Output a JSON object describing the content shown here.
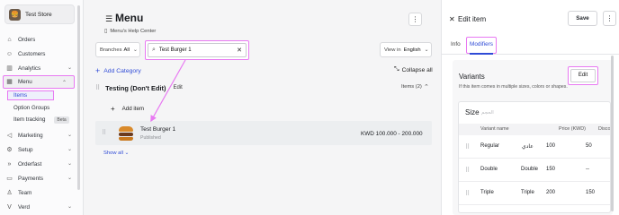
{
  "store": {
    "name": "Test Store",
    "logo_icon": "store-logo-icon"
  },
  "sidebar": {
    "items": [
      {
        "label": "Orders",
        "icon": "home-icon"
      },
      {
        "label": "Customers",
        "icon": "users-icon"
      },
      {
        "label": "Analytics",
        "icon": "chart-icon"
      },
      {
        "label": "Menu",
        "icon": "grid-icon"
      },
      {
        "label": "Marketing",
        "icon": "megaphone-icon"
      },
      {
        "label": "Setup",
        "icon": "gear-icon"
      },
      {
        "label": "Orderfast",
        "icon": "bolt-icon"
      },
      {
        "label": "Payments",
        "icon": "card-icon"
      },
      {
        "label": "Team",
        "icon": "person-icon"
      },
      {
        "label": "Verd",
        "icon": "verd-icon"
      }
    ],
    "menu_sub": [
      {
        "label": "Items"
      },
      {
        "label": "Option Groups"
      },
      {
        "label": "Item tracking",
        "badge": "Beta"
      }
    ]
  },
  "main": {
    "title": "Menu",
    "help": "Menu's Help Center",
    "branches_label": "Branches",
    "branches_value": "All",
    "search_value": "Test Burger 1",
    "view_in_label": "View in",
    "view_in_value": "English",
    "add_category": "Add Category",
    "collapse_all": "Collapse all",
    "category": {
      "title": "Testing (Don't Edit)",
      "edit": "Edit",
      "items_count": "Items (2)",
      "add_item": "Add item"
    },
    "product": {
      "name": "Test Burger 1",
      "status": "Published",
      "price": "KWD 100.000 - 200.000"
    },
    "show_all": "Show all"
  },
  "panel": {
    "title": "Edit item",
    "save": "Save",
    "tabs": {
      "info": "Info",
      "modifiers": "Modifiers"
    },
    "variants": {
      "title": "Variants",
      "subtitle": "If this item comes in multiple sizes, colors or shapes.",
      "edit": "Edit",
      "group": {
        "title": "Size",
        "title_ar": "الحجم",
        "columns": [
          "Variant name",
          "Price (KWD)",
          "Disco"
        ],
        "rows": [
          {
            "name": "Regular",
            "name_ar": "عادي",
            "price": "100",
            "discount": "50"
          },
          {
            "name": "Double",
            "name_ar": "Double",
            "price": "150",
            "discount": "--"
          },
          {
            "name": "Triple",
            "name_ar": "Triple",
            "price": "200",
            "discount": "150"
          }
        ]
      }
    }
  },
  "colors": {
    "accent": "#2f4bd6",
    "highlight": "#e879f2"
  }
}
